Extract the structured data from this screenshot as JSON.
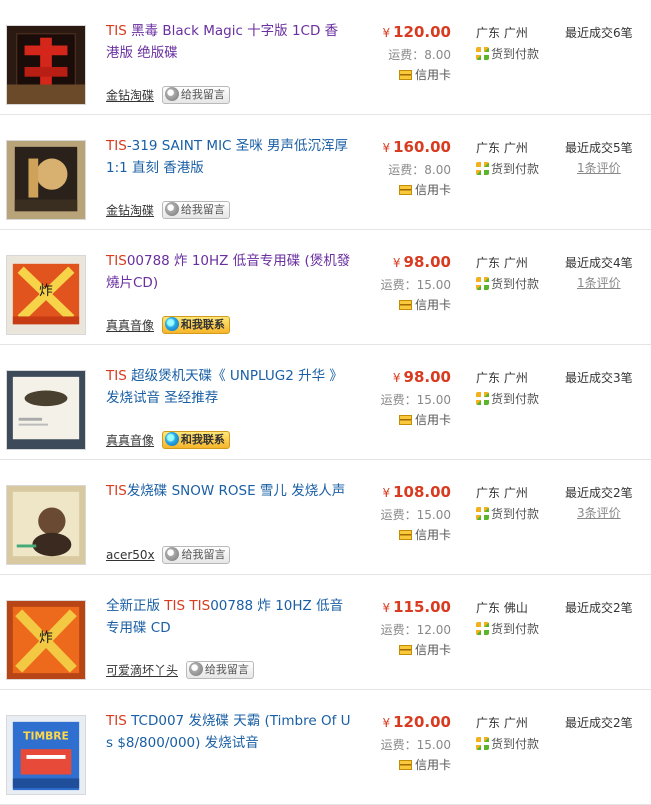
{
  "listings": [
    {
      "title_highlight": "TIS",
      "title_rest": " 黑毒 Black Magic 十字版 1CD 香港版 绝版碟",
      "rest_color": "#6a2fa0",
      "seller": "金钻淘碟",
      "seller_action": "给我留言",
      "seller_action_type": "message",
      "currency_symbol": "¥",
      "price": "120.00",
      "shipping": "运费：8.00",
      "payment": "信用卡",
      "location": "广东 广州",
      "cod": "货到付款",
      "recent_deals": "最近成交6笔",
      "reviews": "",
      "thumb_theme": "black-red"
    },
    {
      "title_highlight": "TIS",
      "title_rest": "-319 SAINT MIC 圣咪 男声低沉浑厚1:1 直刻 香港版",
      "rest_color": "#1a5fa5",
      "seller": "金钻淘碟",
      "seller_action": "给我留言",
      "seller_action_type": "message",
      "currency_symbol": "¥",
      "price": "160.00",
      "shipping": "运费：8.00",
      "payment": "信用卡",
      "location": "广东 广州",
      "cod": "货到付款",
      "recent_deals": "最近成交5笔",
      "reviews": "1条评价",
      "thumb_theme": "dark-gold"
    },
    {
      "title_highlight": "TIS",
      "title_rest": "00788 炸 10HZ 低音专用碟 (煲机發燒片CD)",
      "rest_color": "#6a2fa0",
      "seller": "真真音像",
      "seller_action": "和我联系",
      "seller_action_type": "contact",
      "currency_symbol": "¥",
      "price": "98.00",
      "shipping": "运费：15.00",
      "payment": "信用卡",
      "location": "广东 广州",
      "cod": "货到付款",
      "recent_deals": "最近成交4笔",
      "reviews": "1条评价",
      "thumb_theme": "orange-x"
    },
    {
      "title_highlight": "TIS",
      "title_rest": " 超级煲机天碟《 UNPLUG2 升华 》发烧试音 圣经推荐",
      "rest_color": "#1a5fa5",
      "seller": "真真音像",
      "seller_action": "和我联系",
      "seller_action_type": "contact",
      "currency_symbol": "¥",
      "price": "98.00",
      "shipping": "运费：15.00",
      "payment": "信用卡",
      "location": "广东 广州",
      "cod": "货到付款",
      "recent_deals": "最近成交3笔",
      "reviews": "",
      "thumb_theme": "white-cd"
    },
    {
      "title_highlight": "TIS",
      "title_rest": "发烧碟 SNOW ROSE 雪儿 发烧人声",
      "rest_color": "#1a5fa5",
      "seller": "acer50x",
      "seller_action": "给我留言",
      "seller_action_type": "message",
      "currency_symbol": "¥",
      "price": "108.00",
      "shipping": "运费：15.00",
      "payment": "信用卡",
      "location": "广东 广州",
      "cod": "货到付款",
      "recent_deals": "最近成交2笔",
      "reviews": "3条评价",
      "thumb_theme": "portrait"
    },
    {
      "title_prefix": "全新正版 ",
      "title_highlight": "TIS TIS",
      "title_rest": "00788 炸 10HZ 低音专用碟 CD",
      "rest_color": "#1a5fa5",
      "seller": "可爱滴坏丫头",
      "seller_action": "给我留言",
      "seller_action_type": "message",
      "currency_symbol": "¥",
      "price": "115.00",
      "shipping": "运费：12.00",
      "payment": "信用卡",
      "location": "广东 佛山",
      "cod": "货到付款",
      "recent_deals": "最近成交2笔",
      "reviews": "",
      "thumb_theme": "orange-x2"
    },
    {
      "title_highlight": "TIS",
      "title_rest": " TCD007 发烧碟 天霸 (Timbre Of Us $8/800/000) 发烧试音",
      "rest_color": "#1a5fa5",
      "seller": "",
      "seller_action": "",
      "seller_action_type": "none",
      "currency_symbol": "¥",
      "price": "120.00",
      "shipping": "运费：15.00",
      "payment": "信用卡",
      "location": "广东 广州",
      "cod": "货到付款",
      "recent_deals": "最近成交2笔",
      "reviews": "",
      "thumb_theme": "blue-timbre",
      "thumb_text": "TIMBRE"
    }
  ]
}
